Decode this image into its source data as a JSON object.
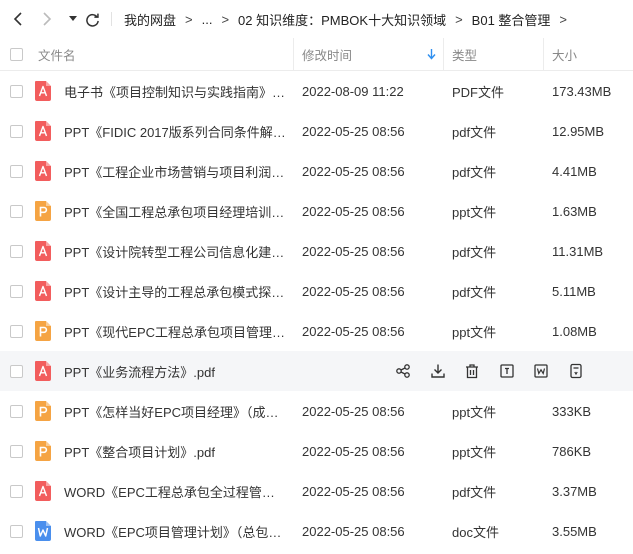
{
  "breadcrumb": {
    "items": [
      "我的网盘",
      "...",
      "02 知识维度：PMBOK十大知识领域",
      "B01 整合管理"
    ],
    "separator": ">"
  },
  "header": {
    "name": "文件名",
    "mtime": "修改时间",
    "type": "类型",
    "size": "大小"
  },
  "colors": {
    "accent": "#2e8ff0",
    "pdf": "#f25d5d",
    "ppt": "#f5a443",
    "doc": "#4a8fed"
  },
  "files": [
    {
      "icon": "pdf-file-icon",
      "name": "电子书《项目控制知识与实践指南》.PDF",
      "mtime": "2022-08-09 11:22",
      "type": "PDF文件",
      "size": "173.43MB"
    },
    {
      "icon": "pdf-file-icon",
      "name": "PPT《FIDIC 2017版系列合同条件解析…",
      "mtime": "2022-05-25 08:56",
      "type": "pdf文件",
      "size": "12.95MB"
    },
    {
      "icon": "pdf-file-icon",
      "name": "PPT《工程企业市场营销与项目利润最…",
      "mtime": "2022-05-25 08:56",
      "type": "pdf文件",
      "size": "4.41MB"
    },
    {
      "icon": "ppt-file-icon",
      "name": "PPT《全国工程总承包项目经理培训讲…",
      "mtime": "2022-05-25 08:56",
      "type": "ppt文件",
      "size": "1.63MB"
    },
    {
      "icon": "pdf-file-icon",
      "name": "PPT《设计院转型工程公司信息化建设…",
      "mtime": "2022-05-25 08:56",
      "type": "pdf文件",
      "size": "11.31MB"
    },
    {
      "icon": "pdf-file-icon",
      "name": "PPT《设计主导的工程总承包模式探索…",
      "mtime": "2022-05-25 08:56",
      "type": "pdf文件",
      "size": "5.11MB"
    },
    {
      "icon": "ppt-file-icon",
      "name": "PPT《现代EPC工程总承包项目管理实务…",
      "mtime": "2022-05-25 08:56",
      "type": "ppt文件",
      "size": "1.08MB"
    },
    {
      "icon": "pdf-file-icon",
      "name": "PPT《业务流程方法》.pdf",
      "mtime": "",
      "type": "",
      "size": ""
    },
    {
      "icon": "ppt-file-icon",
      "name": "PPT《怎样当好EPC项目经理》（成达 …",
      "mtime": "2022-05-25 08:56",
      "type": "ppt文件",
      "size": "333KB"
    },
    {
      "icon": "ppt-file-icon",
      "name": "PPT《整合项目计划》.pdf",
      "mtime": "2022-05-25 08:56",
      "type": "ppt文件",
      "size": "786KB"
    },
    {
      "icon": "pdf-file-icon",
      "name": "WORD《EPC工程总承包全过程管理如…",
      "mtime": "2022-05-25 08:56",
      "type": "pdf文件",
      "size": "3.37MB"
    },
    {
      "icon": "doc-file-icon",
      "name": "WORD《EPC项目管理计划》（总包之…",
      "mtime": "2022-05-25 08:56",
      "type": "doc文件",
      "size": "3.55MB"
    }
  ],
  "hover_row": 7,
  "hover_actions": [
    "share-icon",
    "download-icon",
    "delete-icon",
    "rename-icon",
    "word-convert-icon",
    "more-icon"
  ]
}
